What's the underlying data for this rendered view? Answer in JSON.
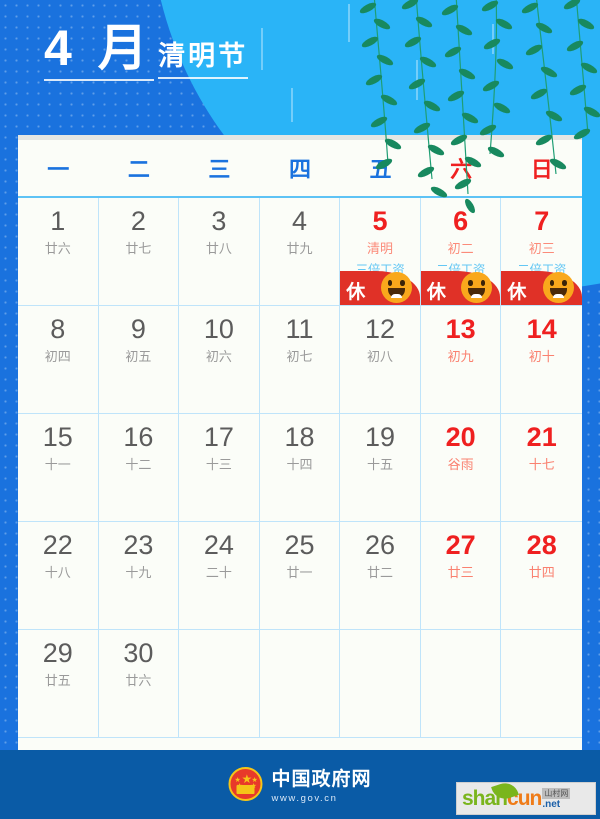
{
  "header": {
    "month": "4 月",
    "festival": "清明节"
  },
  "weekdays": [
    {
      "label": "一",
      "weekend": false
    },
    {
      "label": "二",
      "weekend": false
    },
    {
      "label": "三",
      "weekend": false
    },
    {
      "label": "四",
      "weekend": false
    },
    {
      "label": "五",
      "weekend": false
    },
    {
      "label": "六",
      "weekend": true
    },
    {
      "label": "日",
      "weekend": true
    }
  ],
  "days": [
    {
      "num": "1",
      "lunar": "廿六",
      "style": "normal"
    },
    {
      "num": "2",
      "lunar": "廿七",
      "style": "normal"
    },
    {
      "num": "3",
      "lunar": "廿八",
      "style": "normal"
    },
    {
      "num": "4",
      "lunar": "廿九",
      "style": "normal"
    },
    {
      "num": "5",
      "lunar": "清明",
      "style": "holiday",
      "wage": "三倍工资",
      "badge": "休"
    },
    {
      "num": "6",
      "lunar": "初二",
      "style": "holiday",
      "wage": "二倍工资",
      "badge": "休"
    },
    {
      "num": "7",
      "lunar": "初三",
      "style": "holiday",
      "wage": "二倍工资",
      "badge": "休"
    },
    {
      "num": "8",
      "lunar": "初四",
      "style": "normal"
    },
    {
      "num": "9",
      "lunar": "初五",
      "style": "normal"
    },
    {
      "num": "10",
      "lunar": "初六",
      "style": "normal"
    },
    {
      "num": "11",
      "lunar": "初七",
      "style": "normal"
    },
    {
      "num": "12",
      "lunar": "初八",
      "style": "normal"
    },
    {
      "num": "13",
      "lunar": "初九",
      "style": "weekend"
    },
    {
      "num": "14",
      "lunar": "初十",
      "style": "weekend"
    },
    {
      "num": "15",
      "lunar": "十一",
      "style": "normal"
    },
    {
      "num": "16",
      "lunar": "十二",
      "style": "normal"
    },
    {
      "num": "17",
      "lunar": "十三",
      "style": "normal"
    },
    {
      "num": "18",
      "lunar": "十四",
      "style": "normal"
    },
    {
      "num": "19",
      "lunar": "十五",
      "style": "normal"
    },
    {
      "num": "20",
      "lunar": "谷雨",
      "style": "weekend"
    },
    {
      "num": "21",
      "lunar": "十七",
      "style": "weekend"
    },
    {
      "num": "22",
      "lunar": "十八",
      "style": "normal"
    },
    {
      "num": "23",
      "lunar": "十九",
      "style": "normal"
    },
    {
      "num": "24",
      "lunar": "二十",
      "style": "normal"
    },
    {
      "num": "25",
      "lunar": "廿一",
      "style": "normal"
    },
    {
      "num": "26",
      "lunar": "廿二",
      "style": "normal"
    },
    {
      "num": "27",
      "lunar": "廿三",
      "style": "weekend"
    },
    {
      "num": "28",
      "lunar": "廿四",
      "style": "weekend"
    },
    {
      "num": "29",
      "lunar": "廿五",
      "style": "normal"
    },
    {
      "num": "30",
      "lunar": "廿六",
      "style": "normal"
    },
    {
      "num": "",
      "lunar": "",
      "style": "empty"
    },
    {
      "num": "",
      "lunar": "",
      "style": "empty"
    },
    {
      "num": "",
      "lunar": "",
      "style": "empty"
    },
    {
      "num": "",
      "lunar": "",
      "style": "empty"
    },
    {
      "num": "",
      "lunar": "",
      "style": "empty"
    }
  ],
  "footer": {
    "gov_name": "中国政府网",
    "gov_url": "www.gov.cn"
  },
  "watermark": {
    "part1": "shan",
    "part2": "cun",
    "cn": "山村网",
    "net": ".net"
  },
  "colors": {
    "background_blue": "#1a72de",
    "accent_light_blue": "#2ab4f7",
    "holiday_red": "#ef2020",
    "banner_red": "#e03127",
    "emoji_orange": "#f9a81c",
    "card_bg": "#fbfdf8",
    "grid_line": "#bfe4fa",
    "footer_blue": "#0a5ba6",
    "wage_blue": "#63c7f4"
  }
}
